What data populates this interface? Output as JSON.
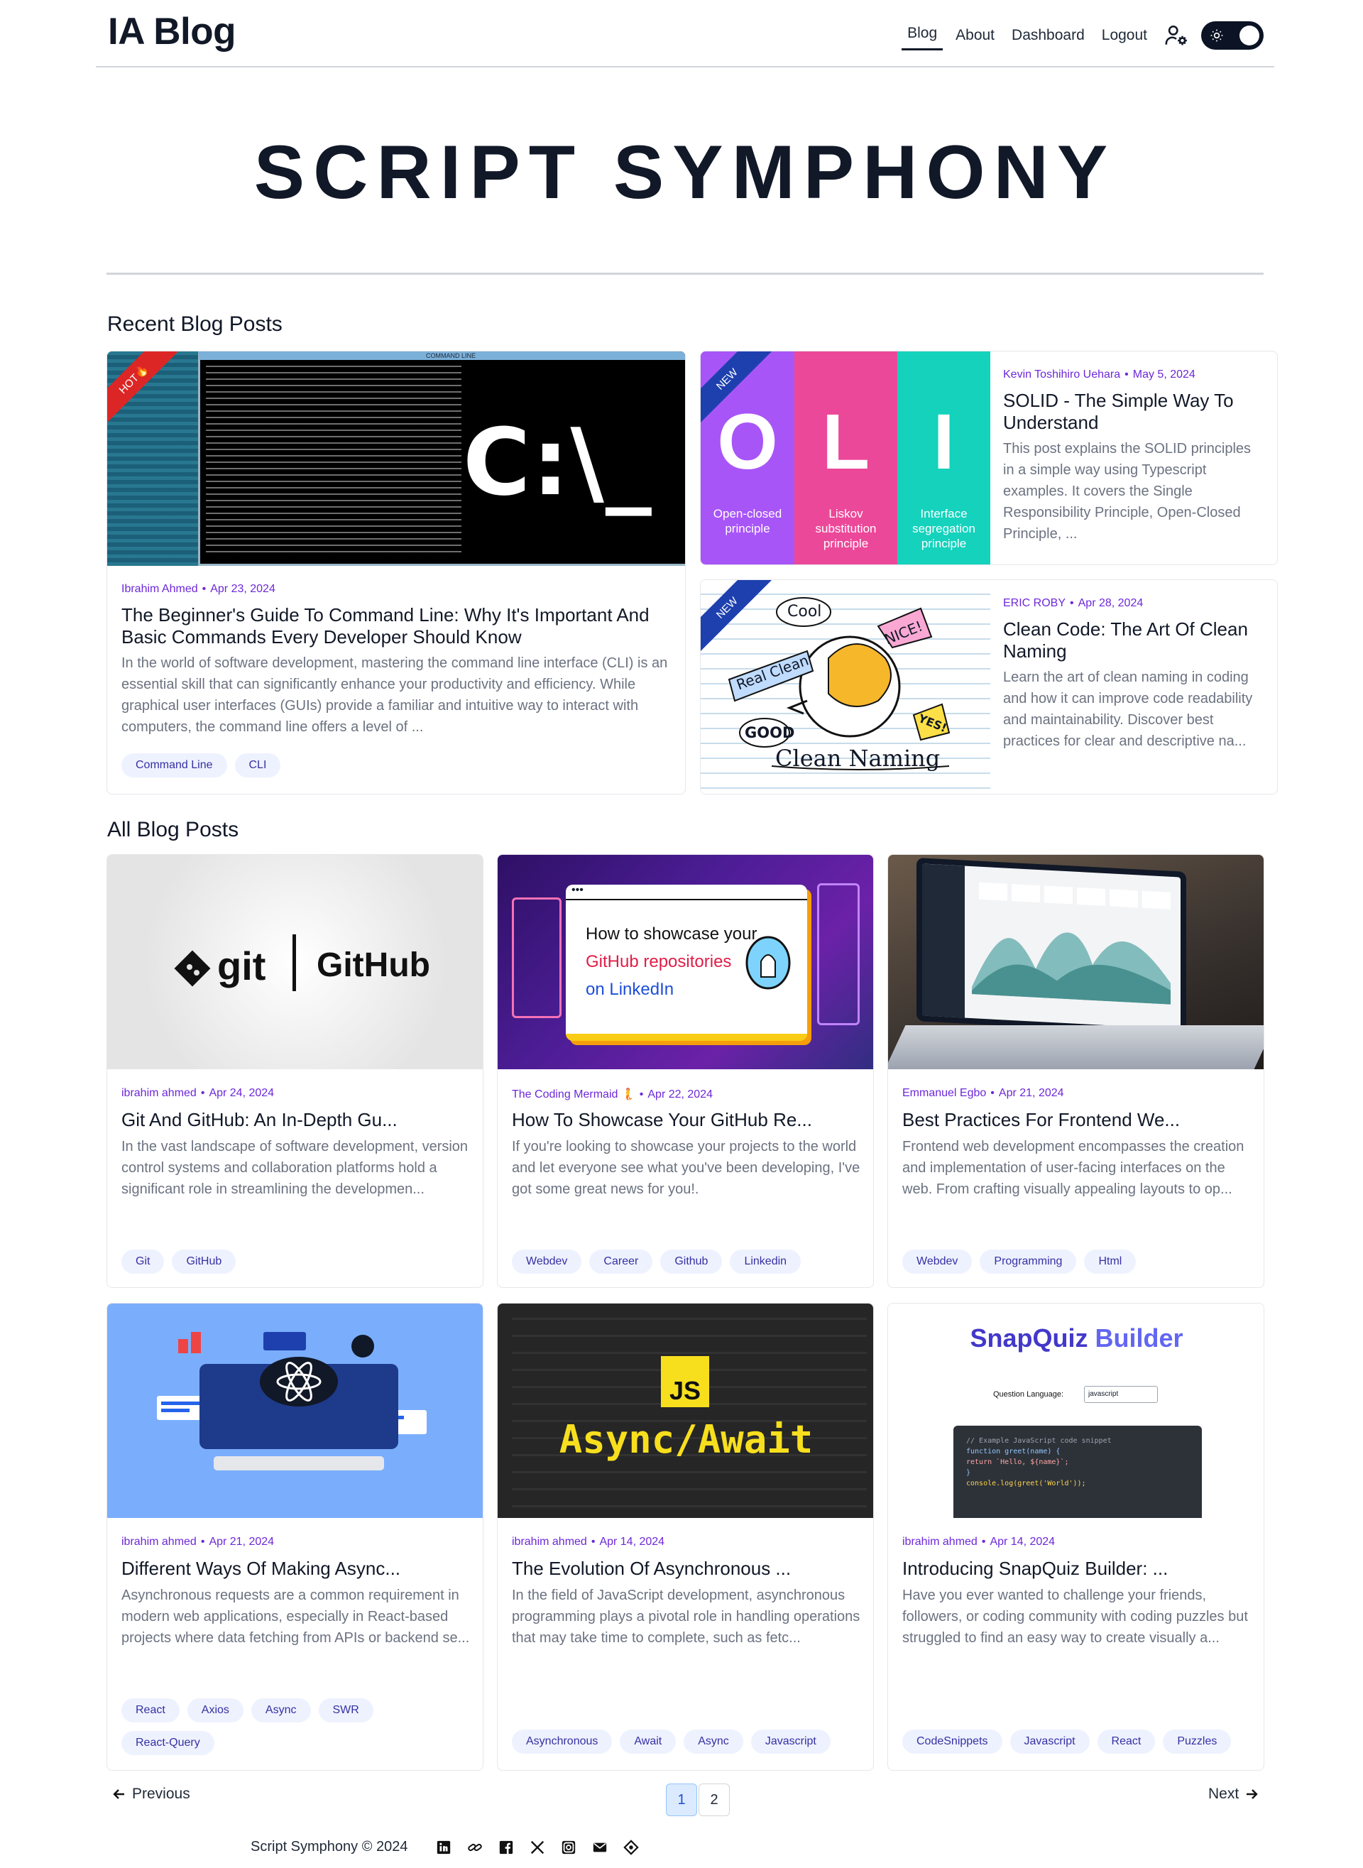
{
  "nav": {
    "brand": "IA Blog",
    "links": [
      "Blog",
      "About",
      "Dashboard",
      "Logout"
    ]
  },
  "hero": {
    "title": "SCRIPT SYMPHONY"
  },
  "recent": {
    "heading": "Recent Blog Posts",
    "posts": [
      {
        "badge": "HOT🔥",
        "author": "Ibrahim Ahmed",
        "date": "Apr 23, 2024",
        "title": "The Beginner's Guide To Command Line: Why It's Important And Basic Commands Every Developer Should Know",
        "excerpt": "In the world of software development, mastering the command line interface (CLI) is an essential skill that can significantly enhance your productivity and efficiency. While graphical user interfaces (GUIs) provide a familiar and intuitive way to interact with computers, the command line offers a level of ...",
        "tags": [
          "Command Line",
          "CLI"
        ],
        "image": {
          "prompt": "C:\\_",
          "window_title": "COMMAND LINE"
        }
      },
      {
        "badge": "NEW",
        "author": "Kevin Toshihiro Uehara",
        "date": "May 5, 2024",
        "title": "SOLID - The Simple Way To Understand",
        "excerpt": "This post explains the SOLID principles in a simple way using Typescript examples. It covers the Single Responsibility Principle, Open-Closed Principle, ...",
        "tags": [],
        "image": {
          "letters": [
            "O",
            "L",
            "I"
          ],
          "captions": [
            "Open-closed principle",
            "Liskov substitution principle",
            "Interface segregation principle"
          ]
        }
      },
      {
        "badge": "NEW",
        "author": "ERIC ROBY",
        "date": "Apr 28, 2024",
        "title": "Clean Code: The Art Of Clean Naming",
        "excerpt": "Learn the art of clean naming in coding and how it can improve code readability and maintainability. Discover best practices for clear and descriptive na...",
        "tags": [],
        "image": {
          "words": [
            "Cool",
            "NICE!",
            "Real Clean",
            "GOOD",
            "YES!",
            "Clean Naming"
          ]
        }
      }
    ]
  },
  "all": {
    "heading": "All Blog Posts",
    "posts": [
      {
        "author": "ibrahim ahmed",
        "date": "Apr 24, 2024",
        "title": "Git And GitHub: An In-Depth Gu...",
        "excerpt": "In the vast landscape of software development, version control systems and collaboration platforms hold a significant role in streamlining the developmen...",
        "tags": [
          "Git",
          "GitHub"
        ],
        "image": {
          "left": "git",
          "right": "GitHub"
        }
      },
      {
        "author": "The Coding Mermaid 🧜",
        "date": "Apr 22, 2024",
        "title": "How To Showcase Your GitHub Re...",
        "excerpt": "If you're looking to showcase your projects to the world and let everyone see what you've been developing, I've got some great news for you!.",
        "tags": [
          "Webdev",
          "Career",
          "Github",
          "Linkedin"
        ],
        "image": {
          "line1": "How to showcase your",
          "line2": "GitHub repositories",
          "line3": "on LinkedIn"
        }
      },
      {
        "author": "Emmanuel Egbo",
        "date": "Apr 21, 2024",
        "title": "Best Practices For Frontend We...",
        "excerpt": "Frontend web development encompasses the creation and implementation of user-facing interfaces on the web. From crafting visually appealing layouts to op...",
        "tags": [
          "Webdev",
          "Programming",
          "Html"
        ]
      },
      {
        "author": "ibrahim ahmed",
        "date": "Apr 21, 2024",
        "title": "Different Ways Of Making Async...",
        "excerpt": "Asynchronous requests are a common requirement in modern web applications, especially in React-based projects where data fetching from APIs or backend se...",
        "tags": [
          "React",
          "Axios",
          "Async",
          "SWR",
          "React-Query"
        ]
      },
      {
        "author": "ibrahim ahmed",
        "date": "Apr 14, 2024",
        "title": "The Evolution Of Asynchronous ...",
        "excerpt": "In the field of JavaScript development, asynchronous programming plays a pivotal role in handling operations that may take time to complete, such as fetc...",
        "tags": [
          "Asynchronous",
          "Await",
          "Async",
          "Javascript"
        ],
        "image": {
          "badge": "JS",
          "text": "Async/Await"
        }
      },
      {
        "author": "ibrahim ahmed",
        "date": "Apr 14, 2024",
        "title": "Introducing SnapQuiz Builder: ...",
        "excerpt": "Have you ever wanted to challenge your friends, followers, or coding community with coding puzzles but struggled to find an easy way to create visually a...",
        "tags": [
          "CodeSnippets",
          "Javascript",
          "React",
          "Puzzles"
        ],
        "image": {
          "brand_a": "SnapQuiz",
          "brand_b": "Builder",
          "label": "Question Language:",
          "select": "javascript",
          "code": [
            "// Example JavaScript code snippet",
            "function greet(name) {",
            "  return `Hello, ${name}`;",
            "}",
            "",
            "console.log(greet('World'));"
          ]
        }
      }
    ]
  },
  "pagination": {
    "prev": "Previous",
    "next": "Next",
    "pages": [
      "1",
      "2"
    ],
    "current": "1"
  },
  "footer": {
    "text": "Script Symphony © 2024",
    "icons": [
      "linkedin-icon",
      "link-icon",
      "facebook-icon",
      "x-icon",
      "instagram-icon",
      "mail-icon",
      "hashnode-icon"
    ]
  },
  "colors": {
    "accent": "#6d28d9",
    "tag_bg": "#eef2ff",
    "tag_text": "#3730a3",
    "hot": "#dc2626",
    "new": "#1e40af"
  }
}
